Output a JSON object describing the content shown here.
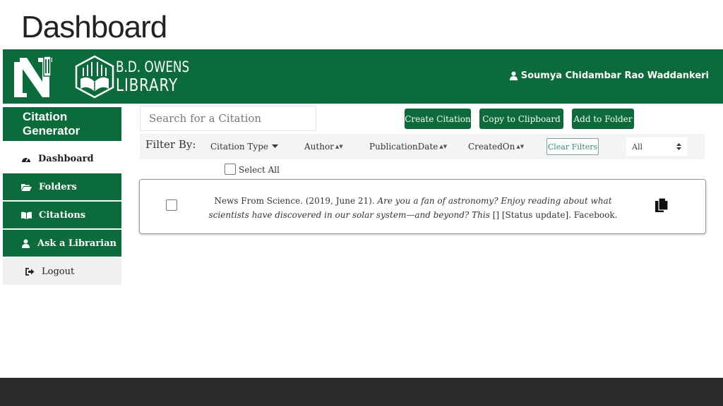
{
  "slide": {
    "title": "Dashboard"
  },
  "header": {
    "library_line1": "B.D. OWENS",
    "library_line2": "LIBRARY",
    "user_name": "Soumya Chidambar Rao Waddankeri"
  },
  "sidebar": {
    "title": "Citation Generator",
    "items": [
      {
        "label": "Dashboard",
        "icon": "tachometer-icon"
      },
      {
        "label": "Folders",
        "icon": "folder-open-icon"
      },
      {
        "label": "Citations",
        "icon": "book-open-icon"
      },
      {
        "label": "Ask a Librarian",
        "icon": "user-icon"
      },
      {
        "label": "Logout",
        "icon": "sign-out-icon"
      }
    ]
  },
  "toolbar": {
    "search_placeholder": "Search for a Citation",
    "create_label": "Create Citation",
    "copy_label": "Copy to Clipboard",
    "folder_label": "Add to Folder"
  },
  "filters": {
    "label": "Filter By:",
    "citation_type": "Citation Type",
    "author": "Author",
    "publication_date": "PublicationDate",
    "created_on": "CreatedOn",
    "clear_label": "Clear Filters",
    "select_value": "All"
  },
  "select_all_label": "Select All",
  "citations": [
    {
      "prefix": "News From Science. (2019, June 21). ",
      "italic": "Are you a fan of astronomy? Enjoy reading about what scientists have discovered in our solar system—and beyond? This",
      "suffix": " [] [Status update]. Facebook."
    }
  ],
  "colors": {
    "brand_green": "#0b6b3a",
    "footer": "#2b2b2b"
  }
}
